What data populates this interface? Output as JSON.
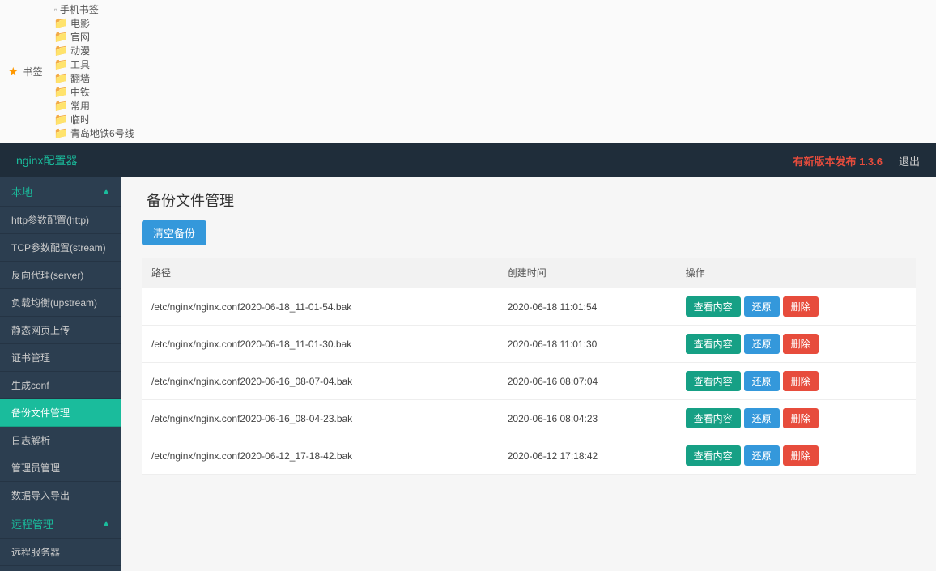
{
  "bookmarks": {
    "first": "书签",
    "items": [
      {
        "icon": "page",
        "label": "手机书签"
      },
      {
        "icon": "folder",
        "label": "电影"
      },
      {
        "icon": "folder",
        "label": "官网"
      },
      {
        "icon": "folder",
        "label": "动漫"
      },
      {
        "icon": "folder",
        "label": "工具"
      },
      {
        "icon": "folder",
        "label": "翻墙"
      },
      {
        "icon": "folder",
        "label": "中铁"
      },
      {
        "icon": "folder",
        "label": "常用"
      },
      {
        "icon": "folder",
        "label": "临时"
      },
      {
        "icon": "folder",
        "label": "青岛地铁6号线"
      }
    ]
  },
  "header": {
    "brand": "nginx配置器",
    "version": "有新版本发布 1.3.6",
    "logout": "退出"
  },
  "sidebar": {
    "sections": [
      {
        "title": "本地",
        "style": "dark",
        "items": [
          {
            "label": "http参数配置(http)",
            "active": false
          },
          {
            "label": "TCP参数配置(stream)",
            "active": false
          },
          {
            "label": "反向代理(server)",
            "active": false
          },
          {
            "label": "负载均衡(upstream)",
            "active": false
          },
          {
            "label": "静态网页上传",
            "active": false
          },
          {
            "label": "证书管理",
            "active": false
          },
          {
            "label": "生成conf",
            "active": false
          },
          {
            "label": "备份文件管理",
            "active": true
          },
          {
            "label": "日志解析",
            "active": false
          },
          {
            "label": "管理员管理",
            "active": false
          },
          {
            "label": "数据导入导出",
            "active": false
          }
        ]
      },
      {
        "title": "远程管理",
        "style": "dark",
        "items": [
          {
            "label": "远程服务器",
            "active": false
          }
        ]
      }
    ]
  },
  "main": {
    "title": "备份文件管理",
    "clear_btn": "清空备份",
    "table": {
      "headers": {
        "path": "路径",
        "time": "创建时间",
        "ops": "操作"
      },
      "ops_labels": {
        "view": "查看内容",
        "restore": "还原",
        "delete": "删除"
      },
      "rows": [
        {
          "path": "/etc/nginx/nginx.conf2020-06-18_11-01-54.bak",
          "time": "2020-06-18 11:01:54"
        },
        {
          "path": "/etc/nginx/nginx.conf2020-06-18_11-01-30.bak",
          "time": "2020-06-18 11:01:30"
        },
        {
          "path": "/etc/nginx/nginx.conf2020-06-16_08-07-04.bak",
          "time": "2020-06-16 08:07:04"
        },
        {
          "path": "/etc/nginx/nginx.conf2020-06-16_08-04-23.bak",
          "time": "2020-06-16 08:04:23"
        },
        {
          "path": "/etc/nginx/nginx.conf2020-06-12_17-18-42.bak",
          "time": "2020-06-12 17:18:42"
        }
      ]
    }
  }
}
